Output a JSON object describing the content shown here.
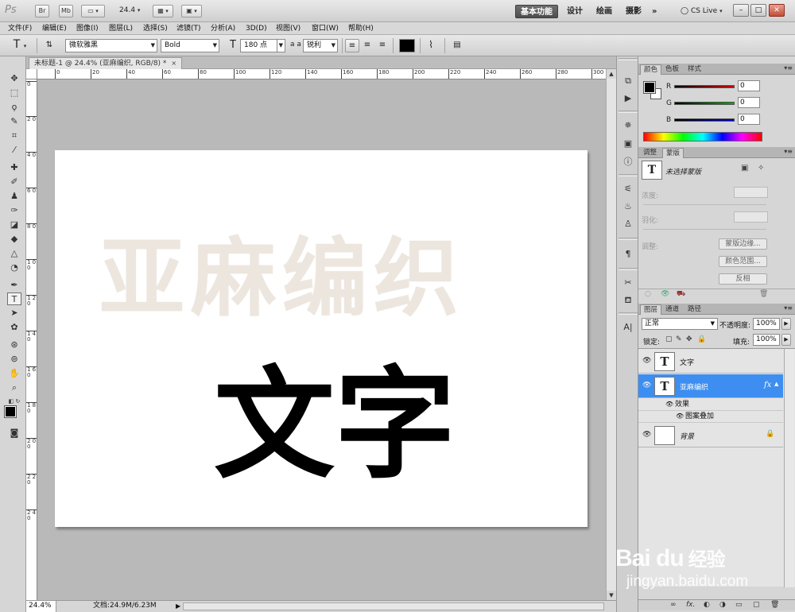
{
  "app": {
    "logo": "Ps",
    "bridge_btn": "Br",
    "minibridge_btn": "Mb",
    "zoom": "24.4",
    "workspaces": [
      "基本功能",
      "设计",
      "绘画",
      "摄影"
    ],
    "more": "»",
    "cslive": "CS Live",
    "window_buttons": [
      "–",
      "□",
      "✕"
    ]
  },
  "menu": [
    "文件(F)",
    "编辑(E)",
    "图像(I)",
    "图层(L)",
    "选择(S)",
    "滤镜(T)",
    "分析(A)",
    "3D(D)",
    "视图(V)",
    "窗口(W)",
    "帮助(H)"
  ],
  "options": {
    "font_family": "微软雅黑",
    "font_style": "Bold",
    "font_size": "180 点",
    "aa_label": "a a",
    "aa_mode": "锐利",
    "text_color": "#000000"
  },
  "document": {
    "tab_title": "未标题-1 @ 24.4% (亚麻编织, RGB/8) *",
    "tab_close": "×",
    "ruler_h": [
      "0",
      "20",
      "40",
      "60",
      "80",
      "100",
      "120",
      "140",
      "160",
      "180",
      "200",
      "220",
      "240",
      "260",
      "280",
      "300"
    ],
    "ruler_v": [
      "0",
      "2 0",
      "4 0",
      "6 0",
      "8 0",
      "1 0 0",
      "1 2 0",
      "1 4 0",
      "1 6 0",
      "1 8 0",
      "2 0 0",
      "2 2 0",
      "2 4 0"
    ],
    "linen_text": "亚麻编织",
    "main_text": "文字"
  },
  "status": {
    "zoom": "24.4%",
    "doc_info": "文档:24.9M/6.23M",
    "arrow": "▶"
  },
  "color_panel": {
    "tabs": [
      "颜色",
      "色板",
      "样式"
    ],
    "channels": [
      {
        "label": "R",
        "value": "0",
        "color": "#cc0000"
      },
      {
        "label": "G",
        "value": "0",
        "color": "#00aa00"
      },
      {
        "label": "B",
        "value": "0",
        "color": "#0000cc"
      }
    ]
  },
  "mask_panel": {
    "tabs": [
      "调整",
      "蒙版"
    ],
    "status": "未选择蒙版",
    "density_label": "浓度:",
    "feather_label": "羽化:",
    "refine_label": "调整:",
    "buttons": [
      "蒙版边缘...",
      "颜色范围...",
      "反相"
    ]
  },
  "layers_panel": {
    "tabs": [
      "图层",
      "通道",
      "路径"
    ],
    "blend_mode": "正常",
    "opacity_label": "不透明度:",
    "opacity": "100%",
    "lock_label": "锁定:",
    "fill_label": "填充:",
    "fill": "100%",
    "layers": [
      {
        "name": "文字",
        "thumb": "T",
        "selected": false
      },
      {
        "name": "亚麻编织",
        "thumb": "T",
        "selected": true,
        "fx": "fx"
      }
    ],
    "effects_label": "效果",
    "effect_item": "图案叠加",
    "background_name": "背景",
    "bottom_icons": [
      "∞",
      "fx.",
      "◐",
      "◑",
      "▭",
      "▢",
      "🗑"
    ]
  },
  "watermark": {
    "brand": "Bai du",
    "suffix": "经验",
    "site": "jingyan.baidu.com"
  }
}
